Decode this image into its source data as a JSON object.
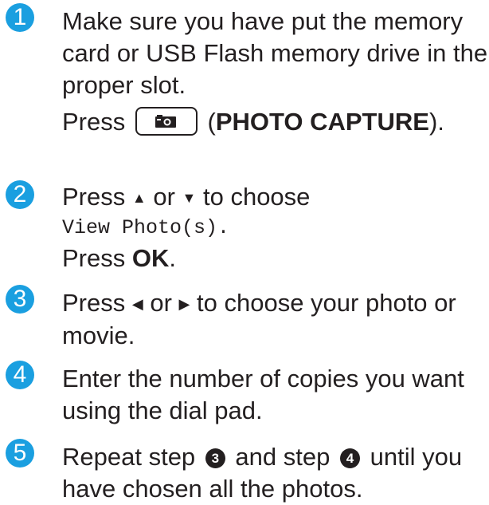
{
  "steps": [
    {
      "number": "1",
      "lines": [
        "Make sure you have put the memory",
        "card or USB Flash memory drive in the",
        "proper slot."
      ],
      "press_prefix": "Press",
      "press_key_icon": "camera-icon",
      "press_open": "(",
      "press_bold": "PHOTO CAPTURE",
      "press_close": ")."
    },
    {
      "number": "2",
      "press": "Press",
      "up_symbol": "▲",
      "or": "or",
      "down_symbol": "▼",
      "to_choose": "to choose",
      "menu_option": "View Photo(s).",
      "press2": "Press",
      "ok": "OK",
      "period": "."
    },
    {
      "number": "3",
      "press": "Press",
      "left_symbol": "◀",
      "or": "or",
      "right_symbol": "▶",
      "rest_line1": "to choose your photo or",
      "line2": "movie."
    },
    {
      "number": "4",
      "lines": [
        "Enter the number of copies you want",
        "using the dial pad."
      ]
    },
    {
      "number": "5",
      "part1": "Repeat step",
      "ref1": "3",
      "part2": "and step",
      "ref2": "4",
      "part3": "until you",
      "line2": "have chosen all the photos."
    }
  ]
}
